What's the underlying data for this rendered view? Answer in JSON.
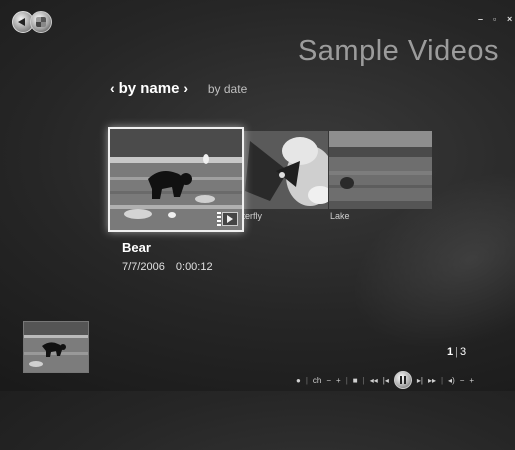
{
  "window": {
    "minimize_glyph": "–",
    "maximize_glyph": "▫",
    "close_glyph": "×"
  },
  "page": {
    "title": "Sample Videos"
  },
  "sort": {
    "prev_arrow": "‹",
    "active": "by name",
    "next_arrow": "›",
    "inactive": "by date"
  },
  "gallery": {
    "items": [
      {
        "label": "Bear"
      },
      {
        "label": "Butterfly"
      },
      {
        "label": "Lake"
      }
    ],
    "visible_captions": {
      "butterfly": "tterfly",
      "lake": "Lake"
    }
  },
  "detail": {
    "title": "Bear",
    "date": "7/7/2006",
    "duration": "0:00:12"
  },
  "pager": {
    "current": "1",
    "separator": "|",
    "total": "3"
  },
  "transport": {
    "dot": "●",
    "ch": "ch",
    "ch_minus": "−",
    "ch_plus": "+",
    "sep": "|",
    "stop": "■",
    "rewind": "◂◂",
    "prev": "|◂",
    "next": "▸|",
    "fast_forward": "▸▸",
    "mute": "◂)",
    "vol_minus": "−",
    "vol_plus": "+"
  },
  "icons": {
    "back": "back-arrow-icon",
    "start": "windows-start-orb-icon",
    "play": "play-icon",
    "pause": "pause-icon"
  }
}
